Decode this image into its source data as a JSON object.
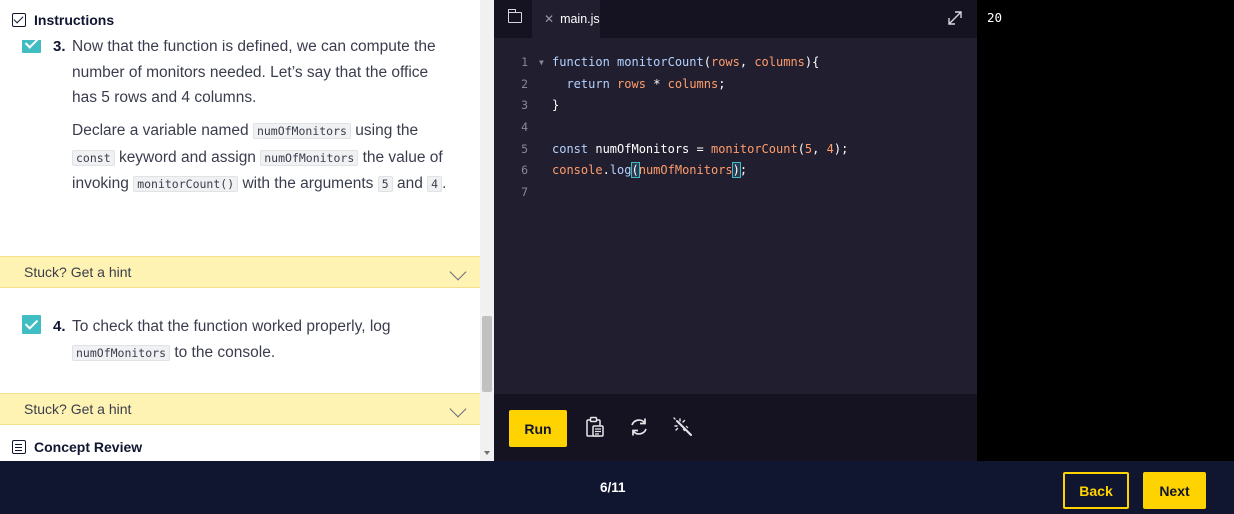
{
  "instructions": {
    "header_title": "Instructions",
    "concept_review": "Concept Review",
    "hint_label": "Stuck? Get a hint",
    "task3": {
      "number": "3.",
      "p1": "Now that the function is defined, we can compute the number of monitors needed. Let’s say that the office has 5 rows and 4 columns.",
      "p2_a": "Declare a variable named",
      "p2_code1": "numOfMonitors",
      "p2_b": "using the",
      "p2_code2": "const",
      "p2_c": "keyword and assign",
      "p2_code3": "numOfMonitors",
      "p2_d": "the value of invoking",
      "p2_code4": "monitorCount()",
      "p2_e": "with the arguments",
      "p2_code5": "5",
      "p2_f": "and",
      "p2_code6": "4",
      "p2_g": "."
    },
    "task4": {
      "number": "4.",
      "text_a": "To check that the function worked properly, log",
      "code": "numOfMonitors",
      "text_b": "to the console."
    }
  },
  "editor": {
    "file_tab": "main.js",
    "line_numbers": [
      "1",
      "2",
      "3",
      "4",
      "5",
      "6",
      "7"
    ],
    "run_label": "Run"
  },
  "output": {
    "text": "20"
  },
  "footer": {
    "progress": "6/11",
    "back_label": "Back",
    "next_label": "Next"
  },
  "colors": {
    "accent": "#ffd300",
    "check": "#3fbdc3",
    "hint_bg": "#fff3b3",
    "navy": "#10162f"
  }
}
